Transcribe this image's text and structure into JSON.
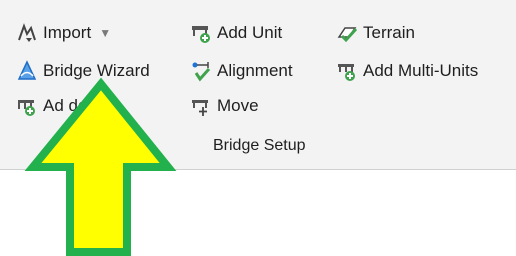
{
  "ribbon": {
    "group_label": "Bridge Setup",
    "commands": {
      "import": {
        "label": "Import",
        "icon": "import-icon",
        "has_dropdown": true
      },
      "bridge_wizard": {
        "label": "Bridge Wizard",
        "icon": "bridge-wizard-icon"
      },
      "add_bridge": {
        "label": "Add Bridge",
        "visible_text": "Ad dge",
        "icon": "add-bridge-icon"
      },
      "add_unit": {
        "label": "Add Unit",
        "icon": "add-unit-icon"
      },
      "alignment": {
        "label": "Alignment",
        "icon": "alignment-icon"
      },
      "move": {
        "label": "Move",
        "icon": "move-icon"
      },
      "terrain": {
        "label": "Terrain",
        "icon": "terrain-icon"
      },
      "add_multi_units": {
        "label": "Add Multi-Units",
        "icon": "add-multi-units-icon"
      }
    }
  },
  "annotation": {
    "type": "arrow",
    "direction": "up",
    "fill": "#ffff00",
    "stroke": "#22b14c"
  },
  "colors": {
    "ribbon_bg": "#f3f3f3",
    "text": "#1f1f1f",
    "accent_green": "#3fa34d",
    "accent_blue": "#1e73d8"
  }
}
